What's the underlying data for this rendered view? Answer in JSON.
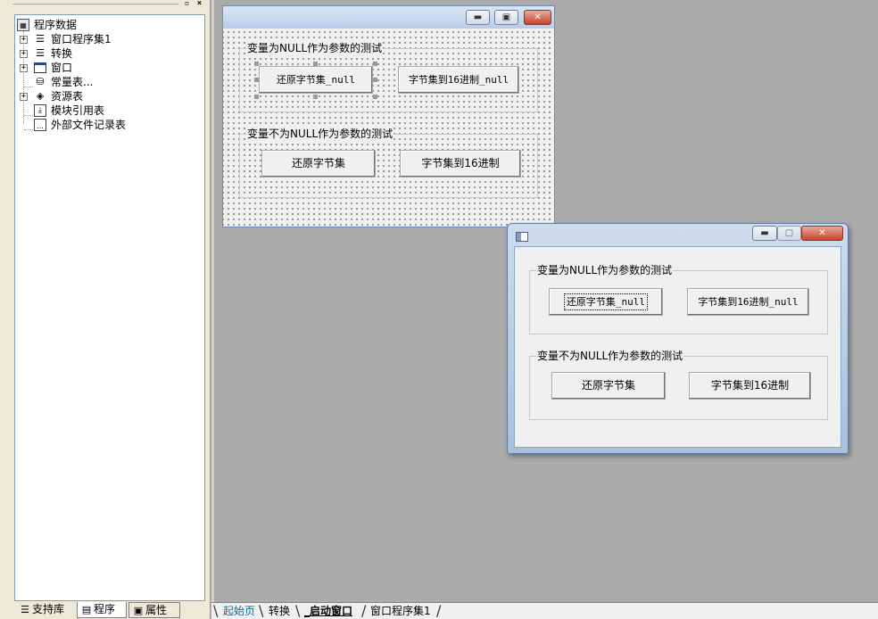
{
  "panel": {
    "pin_icon": "pin-icon",
    "close_icon": "close-icon"
  },
  "tree": {
    "items": [
      {
        "label": "程序数据",
        "icon": "program-data-icon",
        "expandable": false
      },
      {
        "label": "窗口程序集1",
        "icon": "assembly-icon",
        "expandable": true
      },
      {
        "label": "转换",
        "icon": "assembly-icon",
        "expandable": true
      },
      {
        "label": "窗口",
        "icon": "window-icon",
        "expandable": true
      },
      {
        "label": "常量表...",
        "icon": "constants-icon",
        "expandable": false
      },
      {
        "label": "资源表",
        "icon": "resources-icon",
        "expandable": true
      },
      {
        "label": "模块引用表",
        "icon": "module-ref-icon",
        "expandable": false
      },
      {
        "label": "外部文件记录表",
        "icon": "external-files-icon",
        "expandable": false
      }
    ]
  },
  "left_tabs": [
    {
      "label": "支持库",
      "icon": "library-icon",
      "active": false
    },
    {
      "label": "程序",
      "icon": "program-icon",
      "active": true
    },
    {
      "label": "属性",
      "icon": "properties-icon",
      "active": false
    }
  ],
  "form": {
    "group_null_title": "变量为NULL作为参数的测试",
    "group_notnull_title": "变量不为NULL作为参数的测试",
    "btn_restore_null": "还原字节集_null",
    "btn_hex_null": "字节集到16进制_null",
    "btn_restore": "还原字节集",
    "btn_hex": "字节集到16进制"
  },
  "doc_tabs": [
    {
      "label": "起始页",
      "active": false
    },
    {
      "label": "转换",
      "active": false
    },
    {
      "label": "_启动窗口",
      "active": true
    },
    {
      "label": "窗口程序集1",
      "active": false
    }
  ],
  "colors": {
    "workspace": "#ababab",
    "link_tab": "#0a6e96",
    "close_button": "#c7442c"
  }
}
